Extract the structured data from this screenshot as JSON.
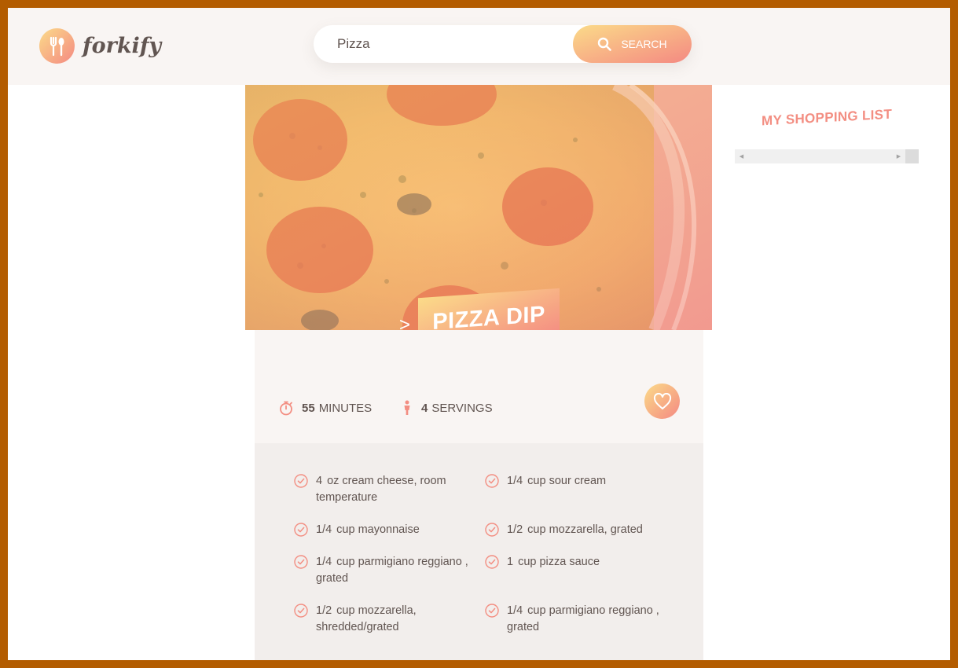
{
  "header": {
    "logo_text": "forkify",
    "logo_icon": "fork-spoon-icon",
    "search": {
      "value": "Pizza",
      "button_label": "SEARCH",
      "button_icon": "search-icon"
    }
  },
  "recipe": {
    "title": "PIZZA DIP",
    "title_arrow": ">",
    "image_alt": "pepperoni pizza dip",
    "cook_time": {
      "value": "55",
      "unit": "MINUTES",
      "icon": "stopwatch-icon"
    },
    "servings": {
      "value": "4",
      "unit": "SERVINGS",
      "icon": "person-icon"
    },
    "like_icon": "heart-icon",
    "ingredients": [
      {
        "count": "4",
        "text": "oz cream cheese, room temperature"
      },
      {
        "count": "1/4",
        "text": "cup sour cream"
      },
      {
        "count": "1/4",
        "text": "cup mayonnaise"
      },
      {
        "count": "1/2",
        "text": "cup mozzarella, grated"
      },
      {
        "count": "1/4",
        "text": "cup parmigiano reggiano , grated"
      },
      {
        "count": "1",
        "text": "cup pizza sauce"
      },
      {
        "count": "1/2",
        "text": "cup mozzarella, shredded/grated"
      },
      {
        "count": "1/4",
        "text": "cup parmigiano reggiano , grated"
      }
    ]
  },
  "shopping": {
    "title": "MY SHOPPING LIST"
  },
  "colors": {
    "accent_start": "#fbdb89",
    "accent_end": "#f48982",
    "text": "#615551",
    "bg_light": "#f9f5f3"
  }
}
